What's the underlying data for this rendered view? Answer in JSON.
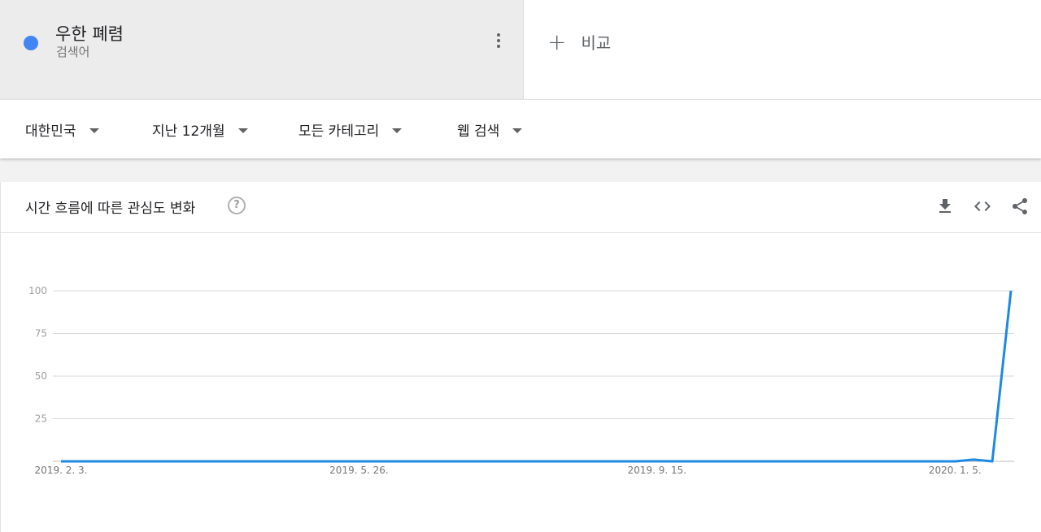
{
  "term": {
    "title": "우한 폐렴",
    "subtitle": "검색어",
    "color": "#4285f4"
  },
  "compare": {
    "label": "비교"
  },
  "filters": {
    "region": "대한민국",
    "period": "지난 12개월",
    "category": "모든 카테고리",
    "search_type": "웹 검색"
  },
  "chart_card": {
    "title": "시간 흐름에 따른 관심도 변화",
    "help": "?",
    "actions": [
      "download-icon",
      "embed-icon",
      "share-icon"
    ]
  },
  "chart_data": {
    "type": "line",
    "title": "시간 흐름에 따른 관심도 변화",
    "xlabel": "",
    "ylabel": "",
    "ylim": [
      0,
      100
    ],
    "yticks": [
      25,
      50,
      75,
      100
    ],
    "xticks": [
      "2019. 2. 3.",
      "2019. 5. 26.",
      "2019. 9. 15.",
      "2020. 1. 5."
    ],
    "xtick_index": [
      0,
      16,
      32,
      48
    ],
    "grid": true,
    "series": [
      {
        "color": "#1e88e5",
        "values": [
          0,
          0,
          0,
          0,
          0,
          0,
          0,
          0,
          0,
          0,
          0,
          0,
          0,
          0,
          0,
          0,
          0,
          0,
          0,
          0,
          0,
          0,
          0,
          0,
          0,
          0,
          0,
          0,
          0,
          0,
          0,
          0,
          0,
          0,
          0,
          0,
          0,
          0,
          0,
          0,
          0,
          0,
          0,
          0,
          0,
          0,
          0,
          0,
          0,
          1,
          0,
          100
        ]
      }
    ]
  }
}
